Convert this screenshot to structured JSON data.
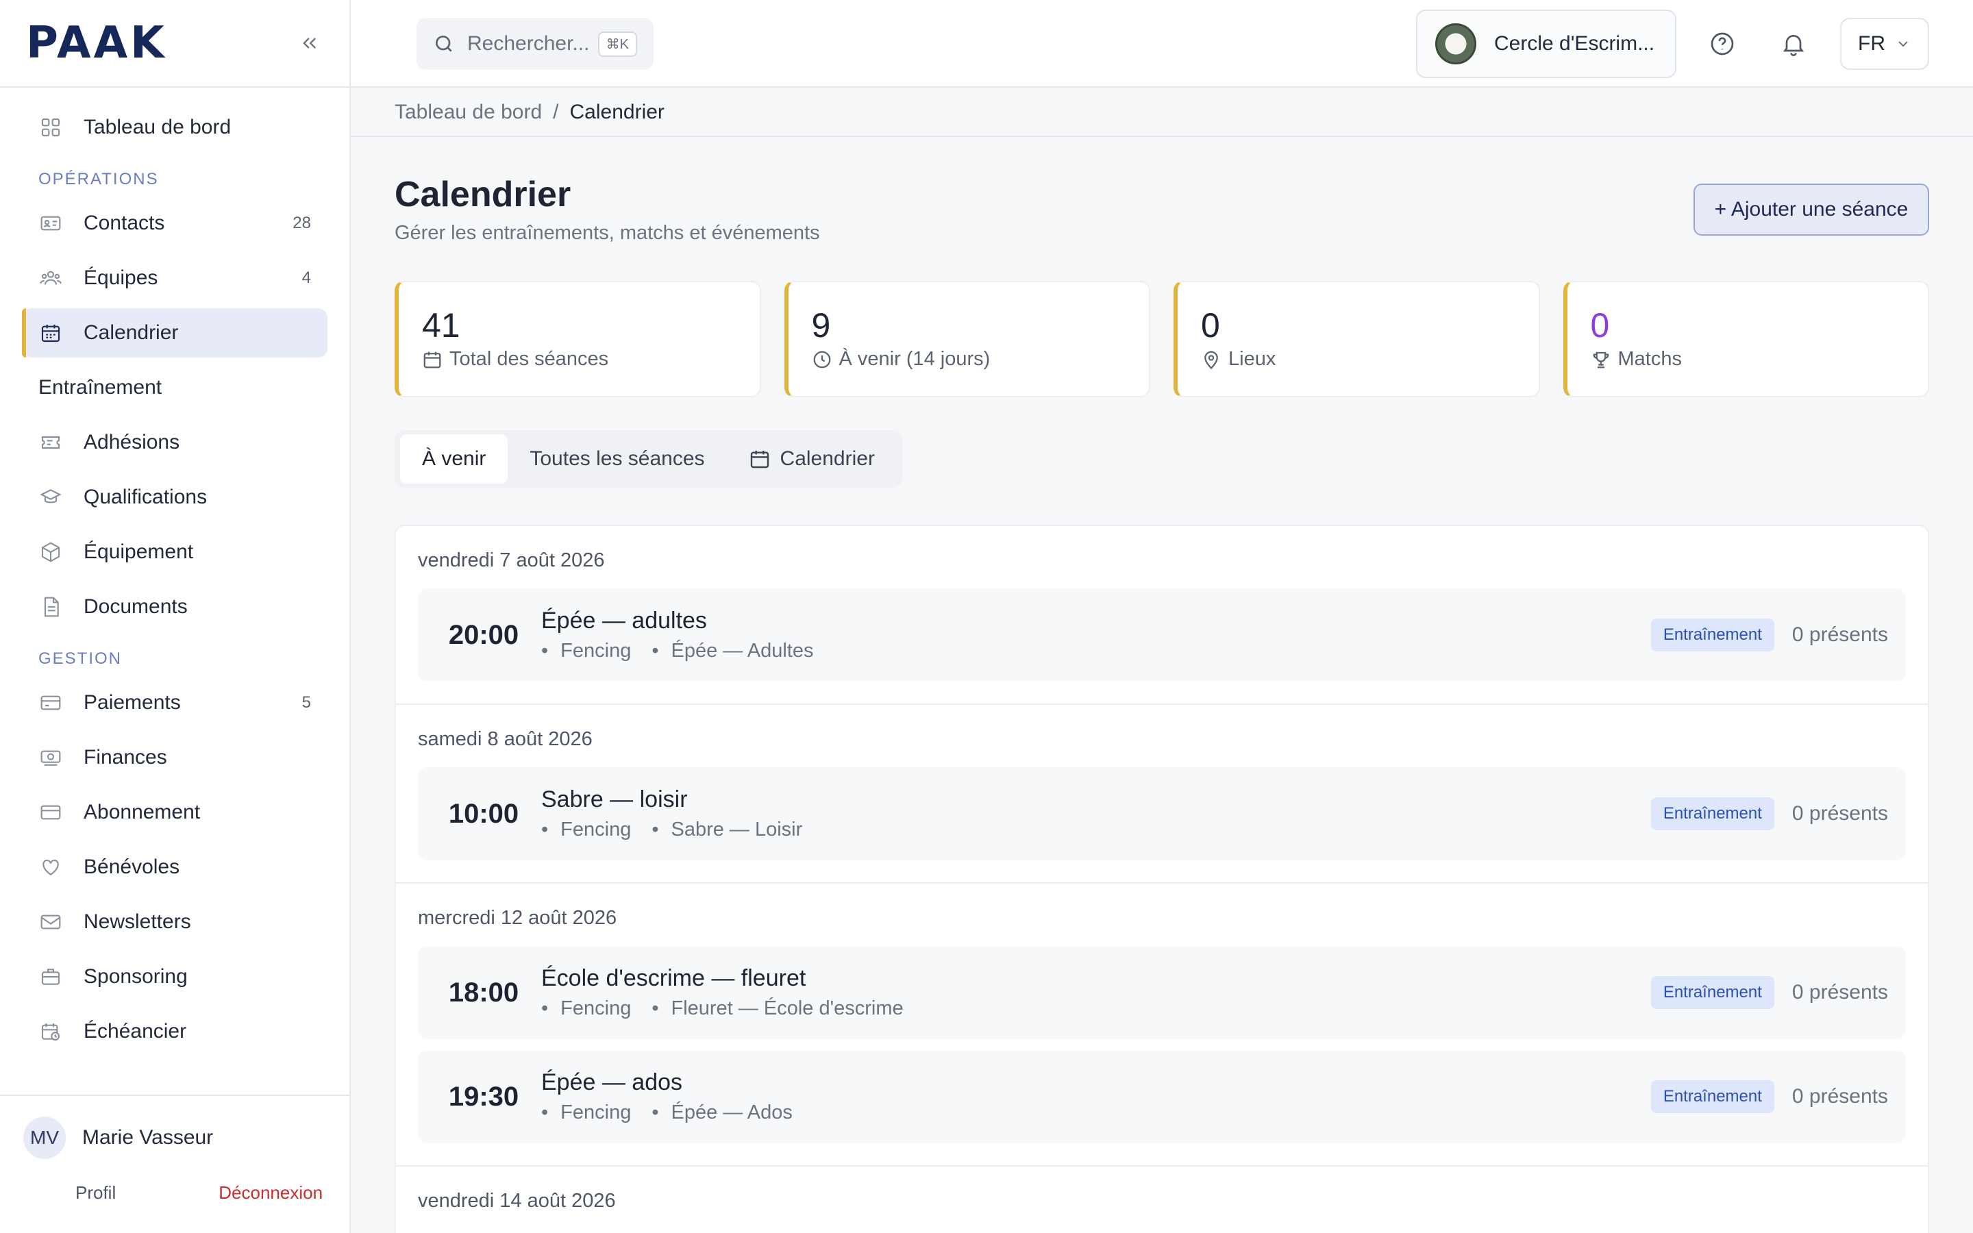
{
  "logo": "PAAK",
  "sidebar": {
    "dashboard": "Tableau de bord",
    "section_operations": "OPÉRATIONS",
    "contacts": {
      "label": "Contacts",
      "count": "28"
    },
    "teams": {
      "label": "Équipes",
      "count": "4"
    },
    "calendar": "Calendrier",
    "training": "Entraînement",
    "memberships": "Adhésions",
    "qualifications": "Qualifications",
    "equipment": "Équipement",
    "documents": "Documents",
    "section_management": "GESTION",
    "payments": {
      "label": "Paiements",
      "count": "5"
    },
    "finances": "Finances",
    "subscription": "Abonnement",
    "volunteers": "Bénévoles",
    "newsletters": "Newsletters",
    "sponsoring": "Sponsoring",
    "schedule": "Échéancier"
  },
  "user": {
    "initials": "MV",
    "name": "Marie Vasseur",
    "profile": "Profil",
    "logout": "Déconnexion"
  },
  "header": {
    "search_placeholder": "Rechercher...",
    "shortcut": "⌘K",
    "club_name": "Cercle d'Escrim...",
    "language": "FR"
  },
  "breadcrumb": {
    "root": "Tableau de bord",
    "sep": "/",
    "current": "Calendrier"
  },
  "page": {
    "title": "Calendrier",
    "subtitle": "Gérer les entraînements, matchs et événements",
    "add_button": "+ Ajouter une séance"
  },
  "stats": [
    {
      "value": "41",
      "label": "Total des séances",
      "icon": "calendar-icon"
    },
    {
      "value": "9",
      "label": "À venir (14 jours)",
      "icon": "clock-icon"
    },
    {
      "value": "0",
      "label": "Lieux",
      "icon": "map-pin-icon"
    },
    {
      "value": "0",
      "label": "Matchs",
      "icon": "trophy-icon",
      "color": "#8b3fe0"
    }
  ],
  "tabs": {
    "upcoming": "À venir",
    "all": "Toutes les séances",
    "calendar": "Calendrier"
  },
  "days": [
    {
      "title": "vendredi 7 août 2026",
      "sessions": [
        {
          "time": "20:00",
          "title": "Épée — adultes",
          "sport": "Fencing",
          "group": "Épée — Adultes",
          "badge": "Entraînement",
          "attendance": "0 présents"
        }
      ]
    },
    {
      "title": "samedi 8 août 2026",
      "sessions": [
        {
          "time": "10:00",
          "title": "Sabre — loisir",
          "sport": "Fencing",
          "group": "Sabre — Loisir",
          "badge": "Entraînement",
          "attendance": "0 présents"
        }
      ]
    },
    {
      "title": "mercredi 12 août 2026",
      "sessions": [
        {
          "time": "18:00",
          "title": "École d'escrime — fleuret",
          "sport": "Fencing",
          "group": "Fleuret — École d'escrime",
          "badge": "Entraînement",
          "attendance": "0 présents"
        },
        {
          "time": "19:30",
          "title": "Épée — ados",
          "sport": "Fencing",
          "group": "Épée — Ados",
          "badge": "Entraînement",
          "attendance": "0 présents"
        }
      ]
    },
    {
      "title": "vendredi 14 août 2026",
      "sessions": []
    }
  ],
  "colors": {
    "accent_gold": "#e2b43c",
    "accent_blue": "#6b7ec2",
    "purple": "#8b3fe0",
    "logout_red": "#c9302c"
  }
}
